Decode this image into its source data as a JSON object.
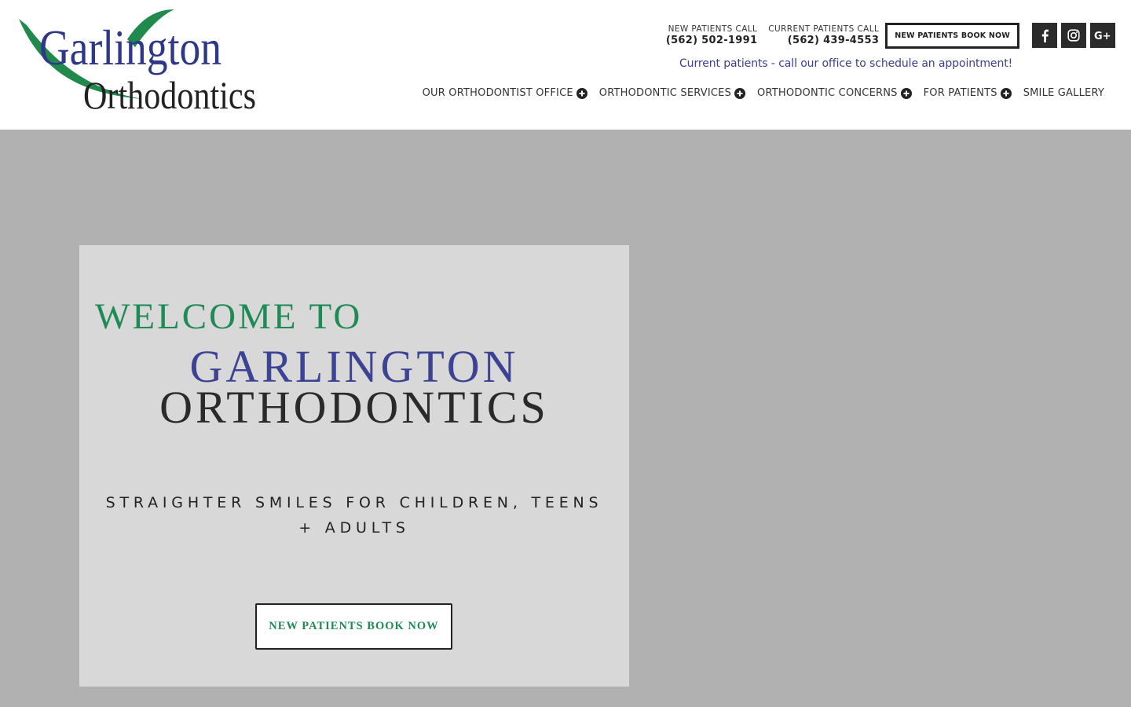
{
  "logo": {
    "line1": "Garlington",
    "line2": "Orthodontics",
    "colors": {
      "blue": "#2f3888",
      "green": "#1f8a4c",
      "black": "#222222"
    }
  },
  "header": {
    "new_patients_label": "NEW PATIENTS CALL",
    "new_patients_phone": "(562) 502-1991",
    "current_patients_label": "CURRENT PATIENTS CALL",
    "current_patients_phone": "(562) 439-4553",
    "book_button": "NEW PATIENTS BOOK NOW",
    "socials": [
      "facebook-icon",
      "instagram-icon",
      "google-plus-icon"
    ],
    "notice": "Current patients - call our office to schedule an appointment!"
  },
  "nav": {
    "items": [
      {
        "label": "OUR ORTHODONTIST OFFICE",
        "has_submenu": true
      },
      {
        "label": "ORTHODONTIC SERVICES",
        "has_submenu": true
      },
      {
        "label": "ORTHODONTIC CONCERNS",
        "has_submenu": true
      },
      {
        "label": "FOR PATIENTS",
        "has_submenu": true
      },
      {
        "label": "SMILE GALLERY",
        "has_submenu": false
      }
    ]
  },
  "hero": {
    "welcome": "WELCOME TO",
    "title_line1": "GARLINGTON",
    "title_line2": "ORTHODONTICS",
    "tagline": "STRAIGHTER SMILES FOR CHILDREN, TEENS + ADULTS",
    "button": "NEW PATIENTS BOOK NOW",
    "colors": {
      "welcome": "#1e8a55",
      "title_line1": "#3d4393",
      "title_line2": "#2a2a2a",
      "background": "#b1b1b1",
      "card": "#d8d8d8"
    }
  }
}
